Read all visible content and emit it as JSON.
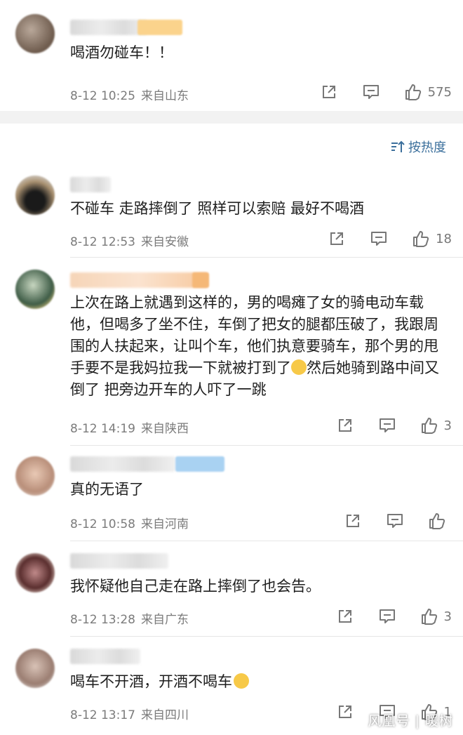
{
  "top_comment": {
    "text": "喝酒勿碰车！！",
    "time": "8-12 10:25",
    "source": "来自山东",
    "likes": "575"
  },
  "sort_label": "按热度",
  "comments": [
    {
      "text": "不碰车 走路摔倒了 照样可以索赔 最好不喝酒",
      "time": "8-12 12:53",
      "source": "来自安徽",
      "likes": "18"
    },
    {
      "text_before_emoji": "上次在路上就遇到这样的，男的喝瘫了女的骑电动车载他，但喝多了坐不住，车倒了把女的腿都压破了，我跟周围的人扶起来，让叫个车，他们执意要骑车，那个男的甩手要不是我妈拉我一下就被打到了",
      "text_after_emoji": "然后她骑到路中间又倒了 把旁边开车的人吓了一跳",
      "time": "8-12 14:19",
      "source": "来自陕西",
      "likes": "3"
    },
    {
      "text": "真的无语了",
      "time": "8-12 10:58",
      "source": "来自河南",
      "likes": ""
    },
    {
      "text": "我怀疑他自己走在路上摔倒了也会告。",
      "time": "8-12 13:28",
      "source": "来自广东",
      "likes": "3"
    },
    {
      "text": "喝车不开酒，开酒不喝车",
      "time": "8-12 13:17",
      "source": "来自四川",
      "likes": "1"
    }
  ],
  "watermark": "风凰号 | 暖树",
  "icons": [
    "share-icon",
    "comment-icon",
    "like-icon",
    "sort-icon",
    "emoji-icon"
  ],
  "colors": {
    "accent_blue": "#3b6f9c",
    "meta_gray": "#7b7b7b",
    "separator": "#f2f2f2"
  }
}
